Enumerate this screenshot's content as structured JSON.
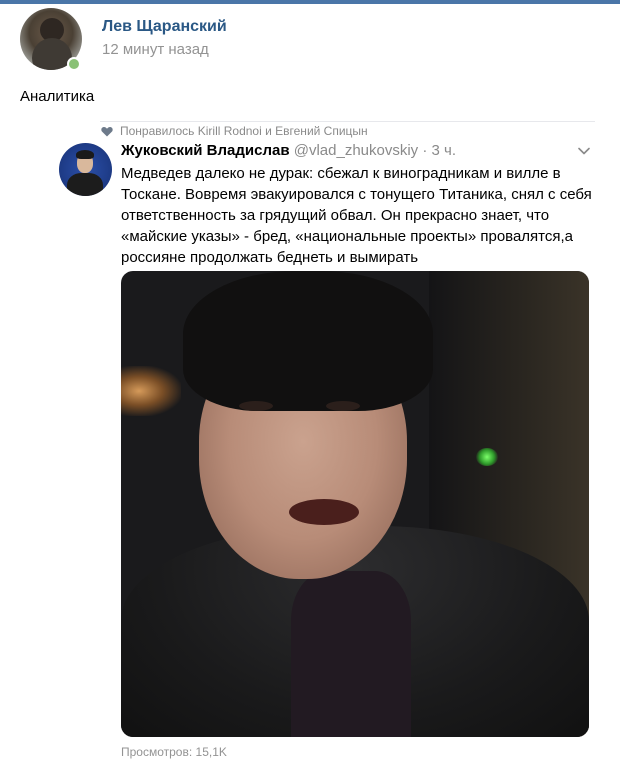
{
  "post": {
    "author": "Лев Щаранский",
    "time": "12 минут назад",
    "text": "Аналитика"
  },
  "repost": {
    "liked_by": "Понравилось Kirill Rodnoi и Евгений Спицын",
    "tweet": {
      "author": "Жуковский Владислав",
      "handle": "@vlad_zhukovskiy",
      "time": "· 3 ч.",
      "text": "Медведев далеко не дурак: сбежал к виноградникам и вилле в Тоскане. Вовремя эвакуировался с тонущего Титаника, снял с себя ответственность за грядущий обвал. Он прекрасно знает, что «майские указы» - бред, «национальные проекты» провалятся,а россияне продолжать беднеть и вымирать"
    },
    "views": "Просмотров: 15,1K"
  },
  "colors": {
    "link": "#2a5885",
    "muted": "#939393",
    "online": "#8ac176",
    "topbar": "#4a76a8"
  }
}
